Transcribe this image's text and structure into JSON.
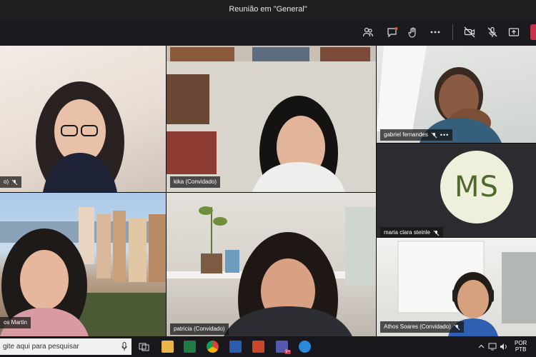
{
  "window": {
    "title": "Reunião em \"General\""
  },
  "toolbar": {
    "icons": [
      "participants-icon",
      "chat-icon",
      "raise-hand-icon",
      "more-actions-icon",
      "camera-off-icon",
      "mic-off-icon",
      "share-screen-icon"
    ],
    "leave_color": "#c4314b"
  },
  "participants": [
    {
      "name": "o)"
    },
    {
      "name": "kika (Convidado)"
    },
    {
      "name": "gabriel fernandes"
    },
    {
      "name": "maria clara steinle",
      "initials": "MS"
    },
    {
      "name": "os Martin"
    },
    {
      "name": "patricia (Convidado)"
    },
    {
      "name": "Athos Soares (Convidado)"
    }
  ],
  "taskbar": {
    "search_placeholder": "gite aqui para pesquisar",
    "teams_badge": "9+",
    "lang_line1": "POR",
    "lang_line2": "PTB",
    "apps": [
      "task-view-icon",
      "file-explorer-icon",
      "excel-icon",
      "chrome-icon",
      "word-icon",
      "powerpoint-icon",
      "teams-icon",
      "edge-icon"
    ]
  },
  "colors": {
    "accent": "#6264a7",
    "titlebar": "#1f1f1f",
    "toolbar": "#1b1a1f",
    "avatar_bg": "#eef0dc",
    "avatar_text": "#4d6a2c"
  }
}
